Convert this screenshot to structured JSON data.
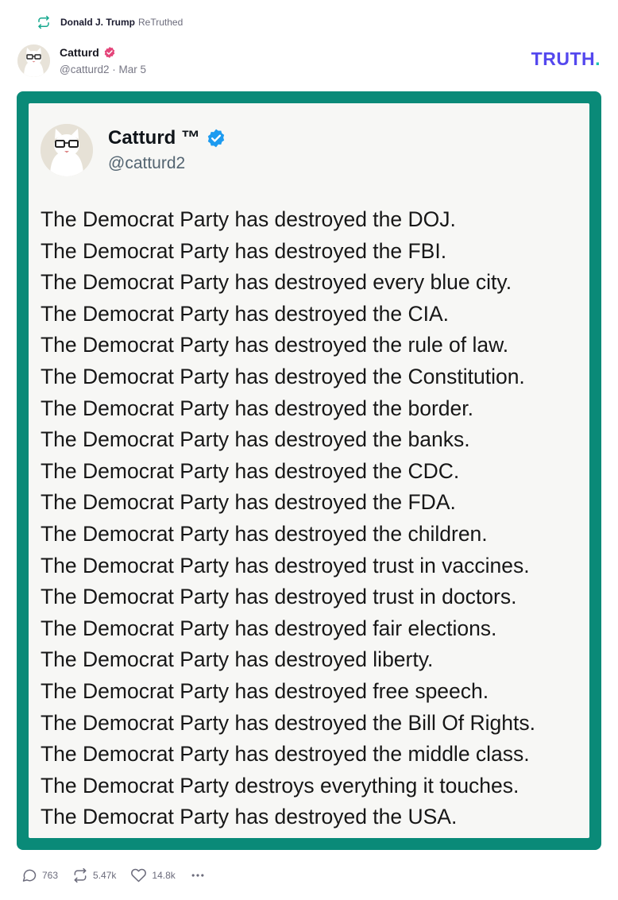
{
  "retruth": {
    "user": "Donald J. Trump",
    "verb": "ReTruthed",
    "icon": "retruth-icon"
  },
  "post": {
    "author": {
      "name": "Catturd",
      "handle": "@catturd2",
      "date": "Mar 5",
      "separator": "·",
      "verified_icon": "verified-badge-icon"
    }
  },
  "brand": {
    "logo_text": "TRUTH",
    "logo_dot": ".",
    "color": "#5448ee",
    "dot_color": "#17c3b2"
  },
  "media": {
    "frame_color": "#0a8a78",
    "tweet": {
      "name": "Catturd ™",
      "handle": "@catturd2",
      "lines": [
        "The Democrat Party has destroyed the DOJ.",
        "The Democrat Party has destroyed the FBI.",
        "The Democrat Party has destroyed every blue city.",
        "The Democrat Party has destroyed the CIA.",
        "The Democrat Party has destroyed the rule of law.",
        "The Democrat Party has destroyed the Constitution.",
        "The Democrat Party has destroyed the border.",
        "The Democrat Party has destroyed the banks.",
        "The Democrat Party has destroyed the CDC.",
        "The Democrat Party has destroyed the FDA.",
        "The Democrat Party has destroyed the children.",
        "The Democrat Party has destroyed trust in vaccines.",
        "The Democrat Party has destroyed trust in doctors.",
        "The Democrat Party has destroyed fair elections.",
        "The Democrat Party has destroyed liberty.",
        "The Democrat Party has destroyed free speech.",
        "The Democrat Party has destroyed the Bill Of Rights.",
        "The Democrat Party has destroyed the middle class.",
        "The Democrat Party destroys everything it touches.",
        "The Democrat Party has destroyed the USA."
      ]
    }
  },
  "actions": {
    "replies": "763",
    "retruths": "5.47k",
    "likes": "14.8k",
    "more_icon": "more-icon"
  }
}
